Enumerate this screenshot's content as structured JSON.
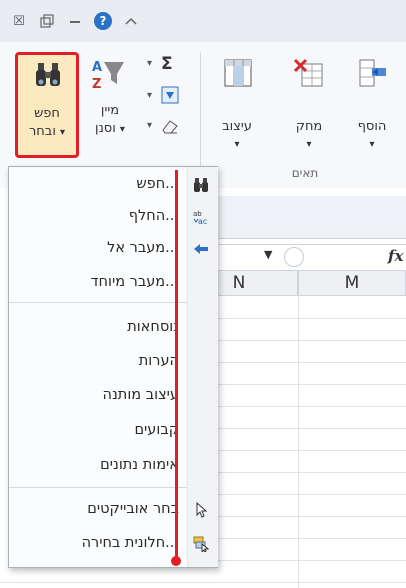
{
  "ribbon": {
    "find_select": {
      "line1": "חפש",
      "line2": "ובחר",
      "arrow": "▾"
    },
    "sort_filter": {
      "line1": "מיין",
      "line2": "וסנן",
      "arrow": "▾"
    },
    "autosum_glyph": "Σ",
    "format": {
      "label": "עיצוב",
      "arrow": "▾"
    },
    "delete": {
      "label": "מחק",
      "arrow": "▾"
    },
    "insert": {
      "label": "הוסף",
      "arrow": "▾"
    },
    "cells_group": "תאים"
  },
  "formula_bar": {
    "fx": "fx"
  },
  "columns": {
    "n": "N",
    "m": "M"
  },
  "menu": {
    "items": [
      {
        "label": "חפש...",
        "icon": "binoculars-icon"
      },
      {
        "label": "החלף...",
        "icon": "replace-icon"
      },
      {
        "label": "מעבר אל...",
        "icon": "goto-arrow-icon"
      },
      {
        "label": "מעבר מיוחד..."
      },
      {
        "label": "נוסחאות"
      },
      {
        "label": "הערות"
      },
      {
        "label": "עיצוב מותנה"
      },
      {
        "label": "קבועים"
      },
      {
        "label": "אימות נתונים"
      },
      {
        "label": "בחר אובייקטים",
        "icon": "select-objects-icon"
      },
      {
        "label": "חלונית בחירה...",
        "icon": "selection-pane-icon"
      }
    ]
  },
  "colors": {
    "highlight": "#e21e26",
    "accent_blue": "#2a72c8"
  }
}
